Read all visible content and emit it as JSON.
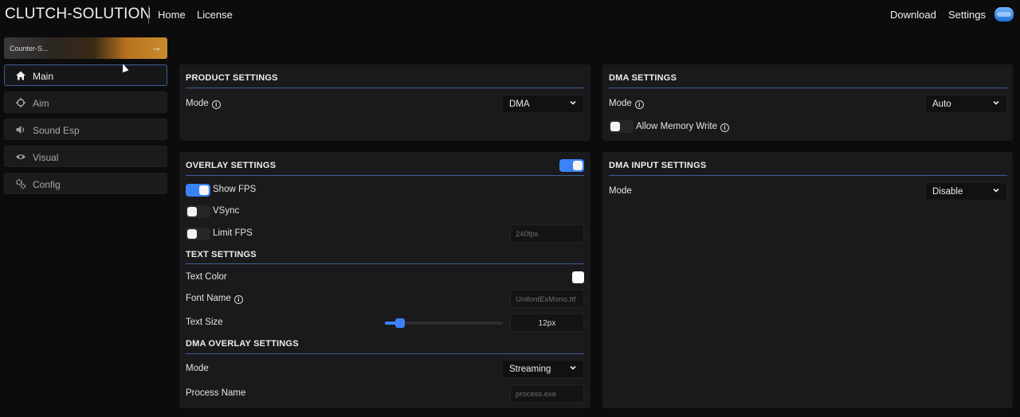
{
  "header": {
    "brand": "CLUTCH-SOLUTION",
    "nav": {
      "home": "Home",
      "license": "License"
    },
    "right": {
      "download": "Download",
      "settings": "Settings"
    }
  },
  "sidebar": {
    "game_card": {
      "label": "Counter-S...",
      "arrow_icon": "arrow-right-icon"
    },
    "items": [
      {
        "label": "Main",
        "icon": "home-icon",
        "active": true
      },
      {
        "label": "Aim",
        "icon": "crosshair-icon",
        "active": false
      },
      {
        "label": "Sound Esp",
        "icon": "speaker-icon",
        "active": false
      },
      {
        "label": "Visual",
        "icon": "eye-icon",
        "active": false
      },
      {
        "label": "Config",
        "icon": "gears-icon",
        "active": false
      }
    ]
  },
  "product_settings": {
    "title": "PRODUCT SETTINGS",
    "mode_label": "Mode",
    "mode_value": "DMA"
  },
  "dma_settings": {
    "title": "DMA SETTINGS",
    "mode_label": "Mode",
    "mode_value": "Auto",
    "allow_memory_write_label": "Allow Memory Write",
    "allow_memory_write": false
  },
  "overlay_settings": {
    "title": "OVERLAY SETTINGS",
    "enabled": true,
    "show_fps_label": "Show FPS",
    "show_fps": true,
    "vsync_label": "VSync",
    "vsync": false,
    "limit_fps_label": "Limit FPS",
    "limit_fps": false,
    "limit_fps_placeholder": "240fps"
  },
  "text_settings": {
    "title": "TEXT SETTINGS",
    "text_color_label": "Text Color",
    "text_color": "#ffffff",
    "font_name_label": "Font Name",
    "font_name_placeholder": "UnifontExMono.ttf",
    "text_size_label": "Text Size",
    "text_size_value": "12px",
    "text_size_slider_fraction": 0.13
  },
  "dma_overlay_settings": {
    "title": "DMA OVERLAY SETTINGS",
    "mode_label": "Mode",
    "mode_value": "Streaming",
    "process_name_label": "Process Name",
    "process_name_placeholder": "process.exe"
  },
  "dma_input_settings": {
    "title": "DMA INPUT SETTINGS",
    "mode_label": "Mode",
    "mode_value": "Disable"
  },
  "colors": {
    "accent": "#3b82f6",
    "panel": "#1a1a1c",
    "background": "#0c0c0d"
  }
}
